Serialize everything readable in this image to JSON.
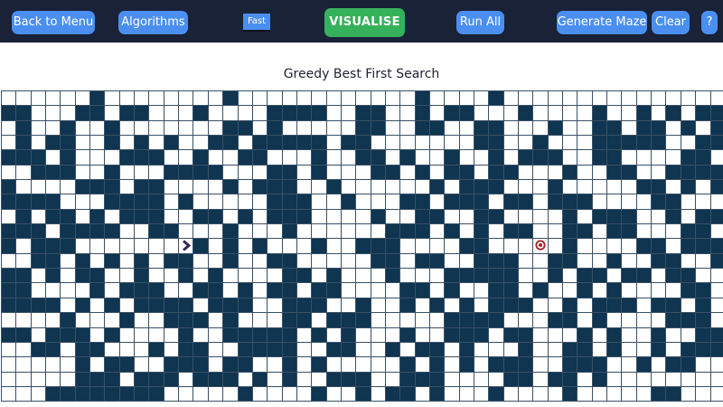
{
  "navbar": {
    "back_label": "Back to Menu",
    "algorithms_label": "Algorithms",
    "speed_label": "Fast",
    "visualise_label": "VISUALISE",
    "run_all_label": "Run All",
    "generate_maze_label": "Generate Maze",
    "clear_label": "Clear",
    "help_label": "?"
  },
  "algorithm_title": "Greedy Best First Search",
  "colors": {
    "navbar": "#1a2238",
    "button": "#4a8ff0",
    "visualise": "#36b15b",
    "wall": "#0f3550",
    "target": "#b01f2e",
    "start": "#3b2360"
  },
  "grid": {
    "cols": 49,
    "rows": 21,
    "start": {
      "row": 10,
      "col": 12,
      "icon": "chevron-right-icon"
    },
    "target": {
      "row": 10,
      "col": 36,
      "icon": "target-icon"
    },
    "walls": [
      "0000001000000001000000000000100001000000000000000",
      "1100011011000100001111001100101100010000100101011",
      "0100100100000001101000001100110011000100110110101",
      "0101100101010011011111011000000011001000111110011",
      "1110100011100100110001001101001001011100110000110",
      "0011100100011110001101000110101101100010011001111",
      "1000011101100001011100100000010111000100000110101",
      "1111000111101000001110010001101110110111000011000",
      "0101101011100110101110000100110011000010111001011",
      "1110111100110001000100000011101010110011011000110",
      "1011100000000101010001001110000110000010000110111",
      "0011010101011001001100000110110011100110010011001",
      "1101011001001010000110100010001111100101101101100",
      "1100001011100110101101100001101001101001010000110",
      "1111010101111011100111001001010101110010111011010",
      "0000100010011101000110111000001111000110100001110",
      "1101110100001001111101010001001110110001010010011",
      "0011011000101100111100110010110100010011010010111",
      "0000010110011101100101000001010101110011100101100",
      "0000011101110111010100111001110000110110100000000",
      "0001111111100000100001001011010001000010000011000"
    ]
  }
}
